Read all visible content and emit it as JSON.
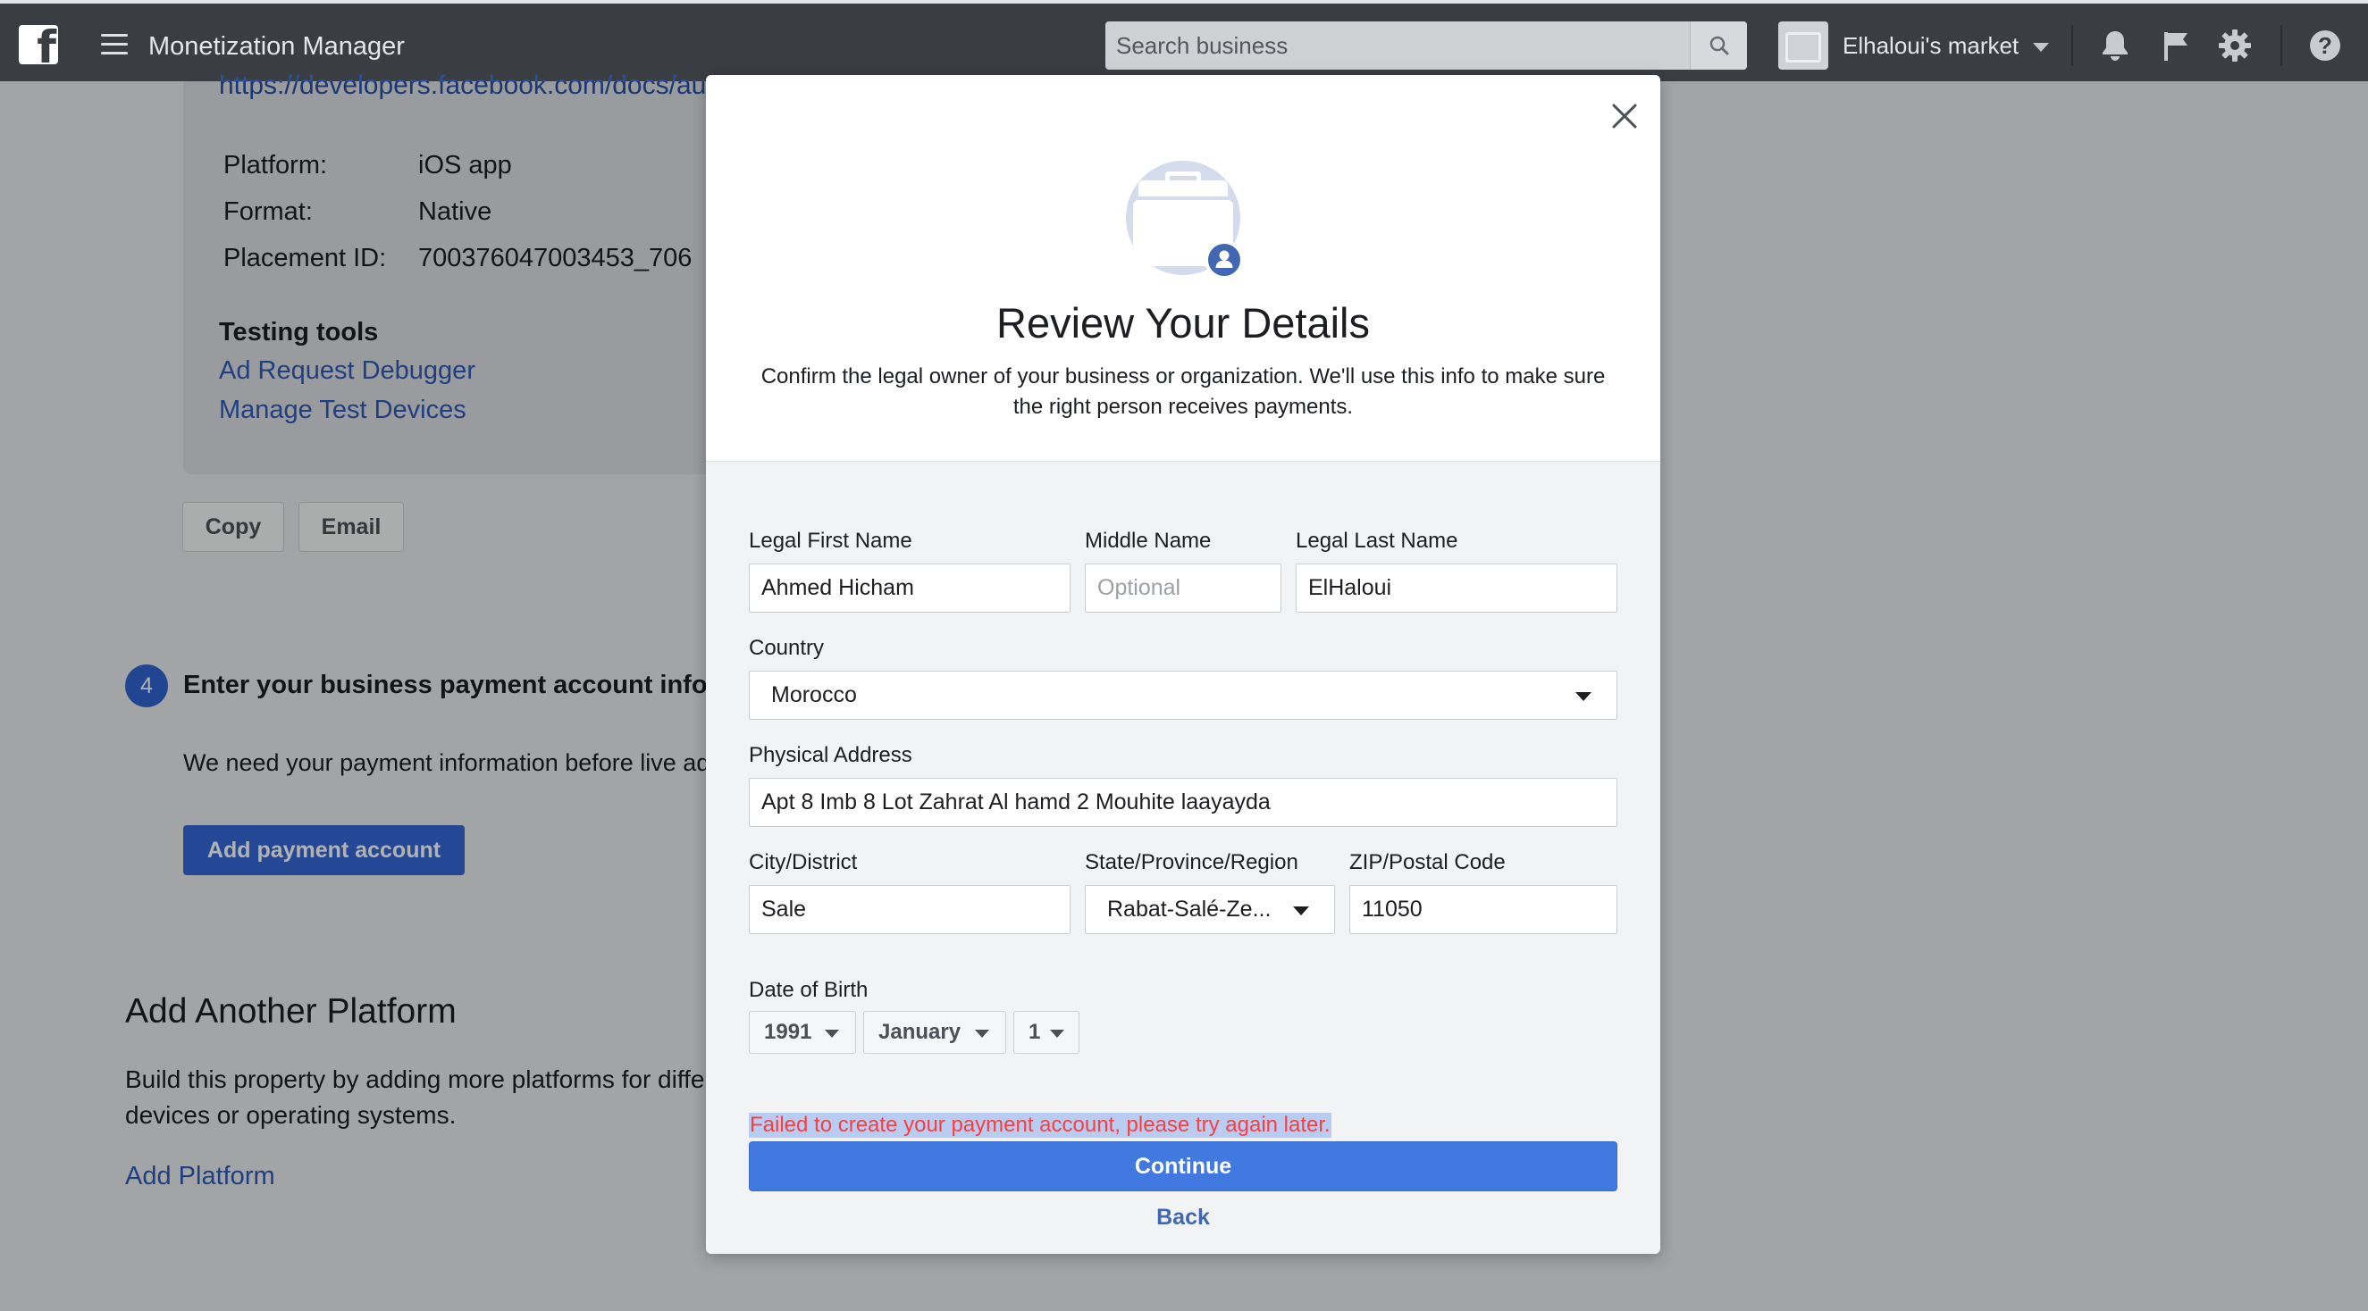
{
  "topbar": {
    "logo": "f",
    "app_title": "Monetization Manager",
    "search": {
      "placeholder": "Search business"
    },
    "account_name": "Elhaloui's market"
  },
  "page": {
    "doc_link": "https://developers.facebook.com/docs/au",
    "details": [
      {
        "label": "Platform:",
        "value": "iOS app"
      },
      {
        "label": "Format:",
        "value": "Native"
      },
      {
        "label": "Placement ID:",
        "value": "700376047003453_706"
      }
    ],
    "testing_tools": {
      "heading": "Testing tools",
      "links": [
        "Ad Request Debugger",
        "Manage Test Devices"
      ]
    },
    "copy_label": "Copy",
    "email_label": "Email",
    "step": {
      "number": "4",
      "title": "Enter your business payment account infor",
      "desc": "We need your payment information before live ad",
      "button": "Add payment account"
    },
    "add_platform": {
      "title": "Add Another Platform",
      "desc": "Build this property by adding more platforms for different devices or operating systems.",
      "link": "Add Platform"
    }
  },
  "modal": {
    "title": "Review Your Details",
    "subtitle": "Confirm the legal owner of your business or organization. We'll use this info to make sure the right person receives payments.",
    "fields": {
      "first_name": {
        "label": "Legal First Name",
        "value": "Ahmed Hicham"
      },
      "middle_name": {
        "label": "Middle Name",
        "value": "",
        "placeholder": "Optional"
      },
      "last_name": {
        "label": "Legal Last Name",
        "value": "ElHaloui"
      },
      "country": {
        "label": "Country",
        "value": "Morocco"
      },
      "address": {
        "label": "Physical Address",
        "value": "Apt 8 Imb 8 Lot Zahrat Al hamd 2 Mouhite laayayda"
      },
      "city": {
        "label": "City/District",
        "value": "Sale"
      },
      "state": {
        "label": "State/Province/Region",
        "value": "Rabat-Salé-Ze..."
      },
      "zip": {
        "label": "ZIP/Postal Code",
        "value": "11050"
      },
      "dob": {
        "label": "Date of Birth",
        "year": "1991",
        "month": "January",
        "day": "1"
      }
    },
    "error": "Failed to create your payment account, please try again later.",
    "continue_label": "Continue",
    "back_label": "Back"
  },
  "colors": {
    "topbar": "#3a3d42",
    "link": "#2d5bb9",
    "primary_button": "#4179e0",
    "error": "#fa3e3e",
    "error_highlight": "#b9cdf3"
  },
  "icons": [
    "facebook-logo-icon",
    "menu-icon",
    "search-icon",
    "chevron-down-icon",
    "bell-icon",
    "flag-icon",
    "gear-icon",
    "help-icon",
    "close-icon",
    "briefcase-icon",
    "user-badge-icon"
  ]
}
